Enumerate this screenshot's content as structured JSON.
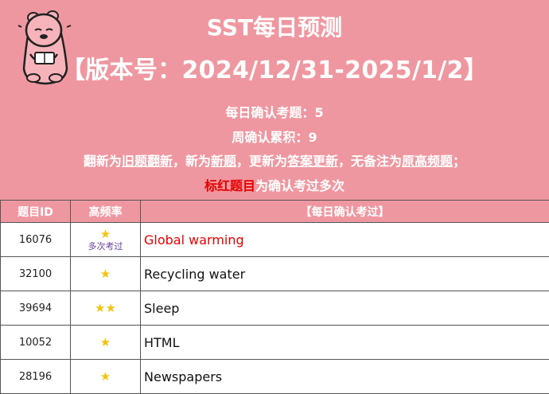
{
  "header": {
    "title": "SST每日预测",
    "version": "【版本号：2024/12/31-2025/1/2】",
    "daily_count_label": "每日确认考题：",
    "daily_count": "5",
    "weekly_count_label": "周确认累积：",
    "weekly_count": "9",
    "legend": {
      "p1": "翻新为",
      "u1": "旧题翻新",
      "p2": "，新为",
      "u2": "新题",
      "p3": "，更新为",
      "u3": "答案更新",
      "p4": "，无备注为",
      "u4": "原高频题",
      "p5": "；"
    },
    "red_note": "标红题目",
    "red_note_suffix": "为确认考过多次"
  },
  "table": {
    "columns": [
      "题目ID",
      "高频率",
      "【每日确认考过】"
    ],
    "rows": [
      {
        "id": "16076",
        "stars": "★",
        "note": "多次考过",
        "topic": "Global warming",
        "hot": true
      },
      {
        "id": "32100",
        "stars": "★",
        "note": "",
        "topic": "Recycling water",
        "hot": false
      },
      {
        "id": "39694",
        "stars": "★★",
        "note": "",
        "topic": "Sleep",
        "hot": false
      },
      {
        "id": "10052",
        "stars": "★",
        "note": "",
        "topic": "HTML",
        "hot": false
      },
      {
        "id": "28196",
        "stars": "★",
        "note": "",
        "topic": "Newspapers",
        "hot": false
      }
    ]
  },
  "colors": {
    "banner": "#ef97a0",
    "highlight_red": "#e60000",
    "star": "#f1c40f",
    "note_purple": "#6a3fa0"
  },
  "icons": {
    "mascot": "reading-bear-icon"
  }
}
